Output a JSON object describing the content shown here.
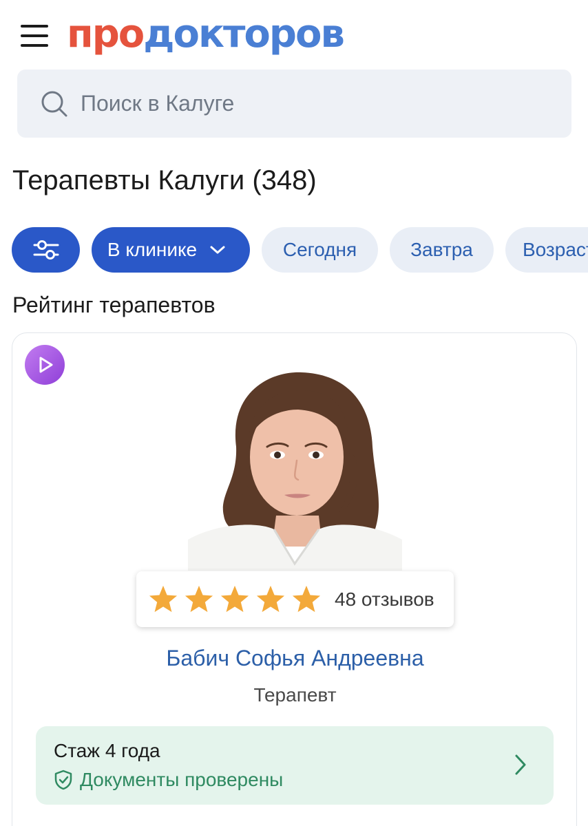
{
  "header": {
    "logo_part1": "про",
    "logo_part2": "докторов",
    "menu_icon": "hamburger-menu-icon"
  },
  "search": {
    "placeholder": "Поиск в Калуге",
    "value": "",
    "icon": "search-icon"
  },
  "page_title": "Терапевты Калуги (348)",
  "filters": {
    "settings_icon": "sliders-icon",
    "chips": [
      {
        "label": "В клинике",
        "active": true,
        "has_dropdown": true
      },
      {
        "label": "Сегодня",
        "active": false
      },
      {
        "label": "Завтра",
        "active": false
      },
      {
        "label": "Возраст",
        "active": false
      }
    ]
  },
  "section_title": "Рейтинг терапевтов",
  "doctor_card": {
    "video_icon": "play-icon",
    "photo_icon": "doctor-photo",
    "rating_stars": 5,
    "reviews": "48 отзывов",
    "name": "Бабич Софья Андреевна",
    "specialty": "Терапевт",
    "experience": "Стаж 4 года",
    "verified": "Документы проверены",
    "verified_icon": "shield-check-icon"
  },
  "colors": {
    "logo_red": "#e5533d",
    "logo_blue": "#4a7fd4",
    "primary": "#2a58c8",
    "chip_light": "#e9eef6",
    "link_blue": "#2c5fa8",
    "star": "#f3a93a",
    "success_bg": "#e4f4ec",
    "success_text": "#2f8a61"
  }
}
